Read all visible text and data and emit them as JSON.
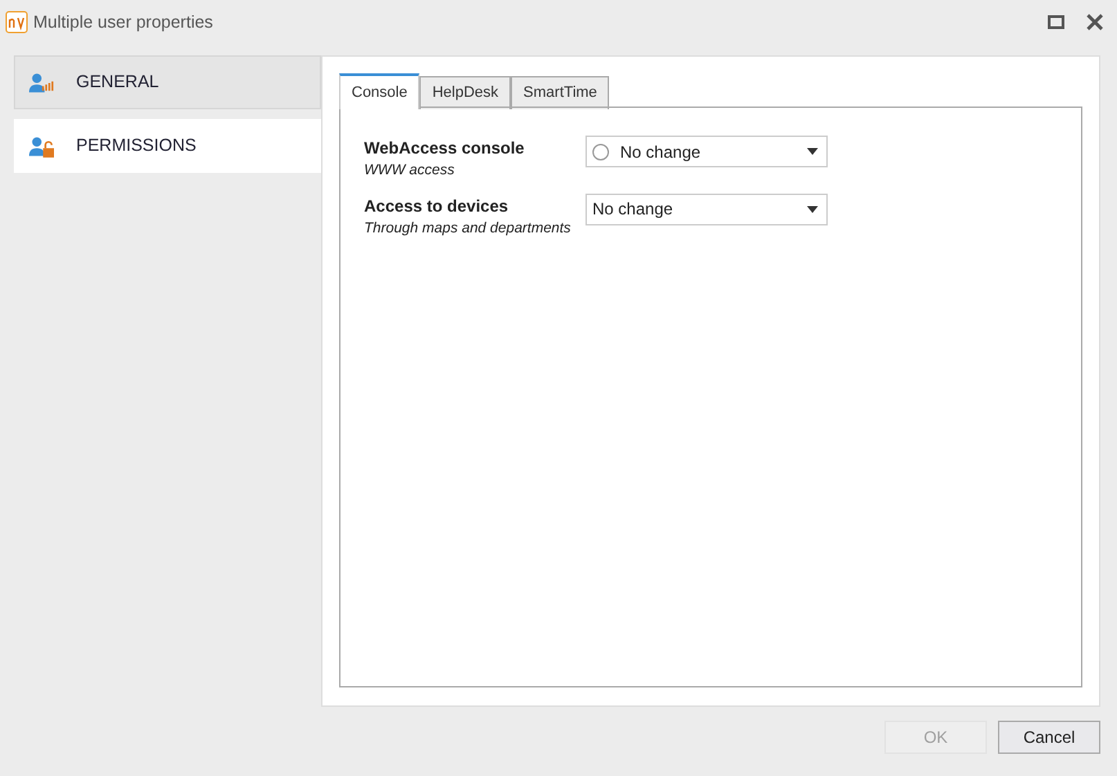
{
  "window": {
    "title": "Multiple user properties"
  },
  "sidebar": {
    "items": [
      {
        "label": "GENERAL",
        "selected": false
      },
      {
        "label": "PERMISSIONS",
        "selected": true
      }
    ]
  },
  "tabs": [
    {
      "label": "Console",
      "selected": true
    },
    {
      "label": "HelpDesk",
      "selected": false
    },
    {
      "label": "SmartTime",
      "selected": false
    }
  ],
  "settings": [
    {
      "label": "WebAccess console",
      "hint": "WWW access",
      "kind": "radio-dropdown",
      "checked": false,
      "value": "No change"
    },
    {
      "label": "Access to devices",
      "hint": "Through maps and departments",
      "kind": "dropdown",
      "value": "No change"
    }
  ],
  "buttons": [
    {
      "label": "OK",
      "disabled": true
    },
    {
      "label": "Cancel",
      "disabled": false
    }
  ]
}
